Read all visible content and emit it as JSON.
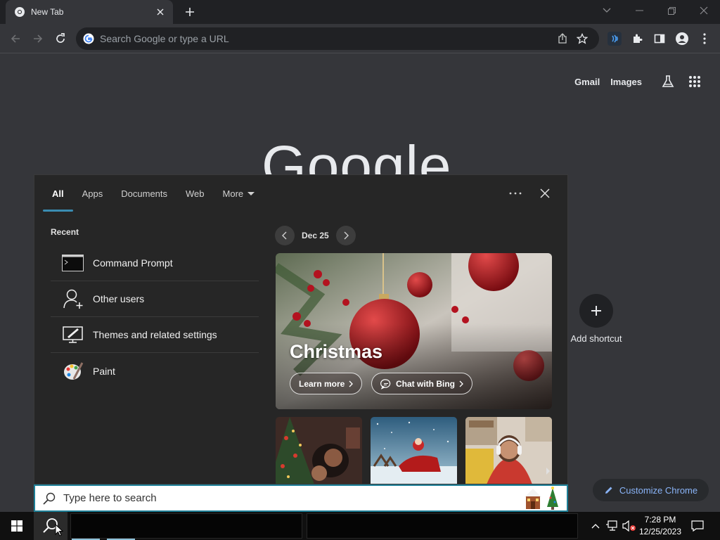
{
  "browser": {
    "tab_title": "New Tab",
    "omnibox_placeholder": "Search Google or type a URL"
  },
  "ntp": {
    "gmail": "Gmail",
    "images": "Images",
    "logo_text": "Google",
    "add_shortcut": "Add shortcut",
    "customize": "Customize Chrome"
  },
  "search_panel": {
    "tabs": [
      "All",
      "Apps",
      "Documents",
      "Web",
      "More"
    ],
    "recent_heading": "Recent",
    "recent": [
      {
        "label": "Command Prompt",
        "icon": "command-prompt-icon"
      },
      {
        "label": "Other users",
        "icon": "user-add-icon"
      },
      {
        "label": "Themes and related settings",
        "icon": "themes-icon"
      },
      {
        "label": "Paint",
        "icon": "paint-icon"
      }
    ],
    "date": "Dec 25",
    "hero": {
      "title": "Christmas",
      "learn_more": "Learn more",
      "chat_with_bing": "Chat with Bing"
    }
  },
  "search_box": {
    "placeholder": "Type here to search"
  },
  "taskbar": {
    "time": "7:28 PM",
    "date": "12/25/2023"
  },
  "colors": {
    "accent": "#3a8cb2",
    "search_border": "#1d7f97",
    "link_blue": "#8ab4f8"
  }
}
